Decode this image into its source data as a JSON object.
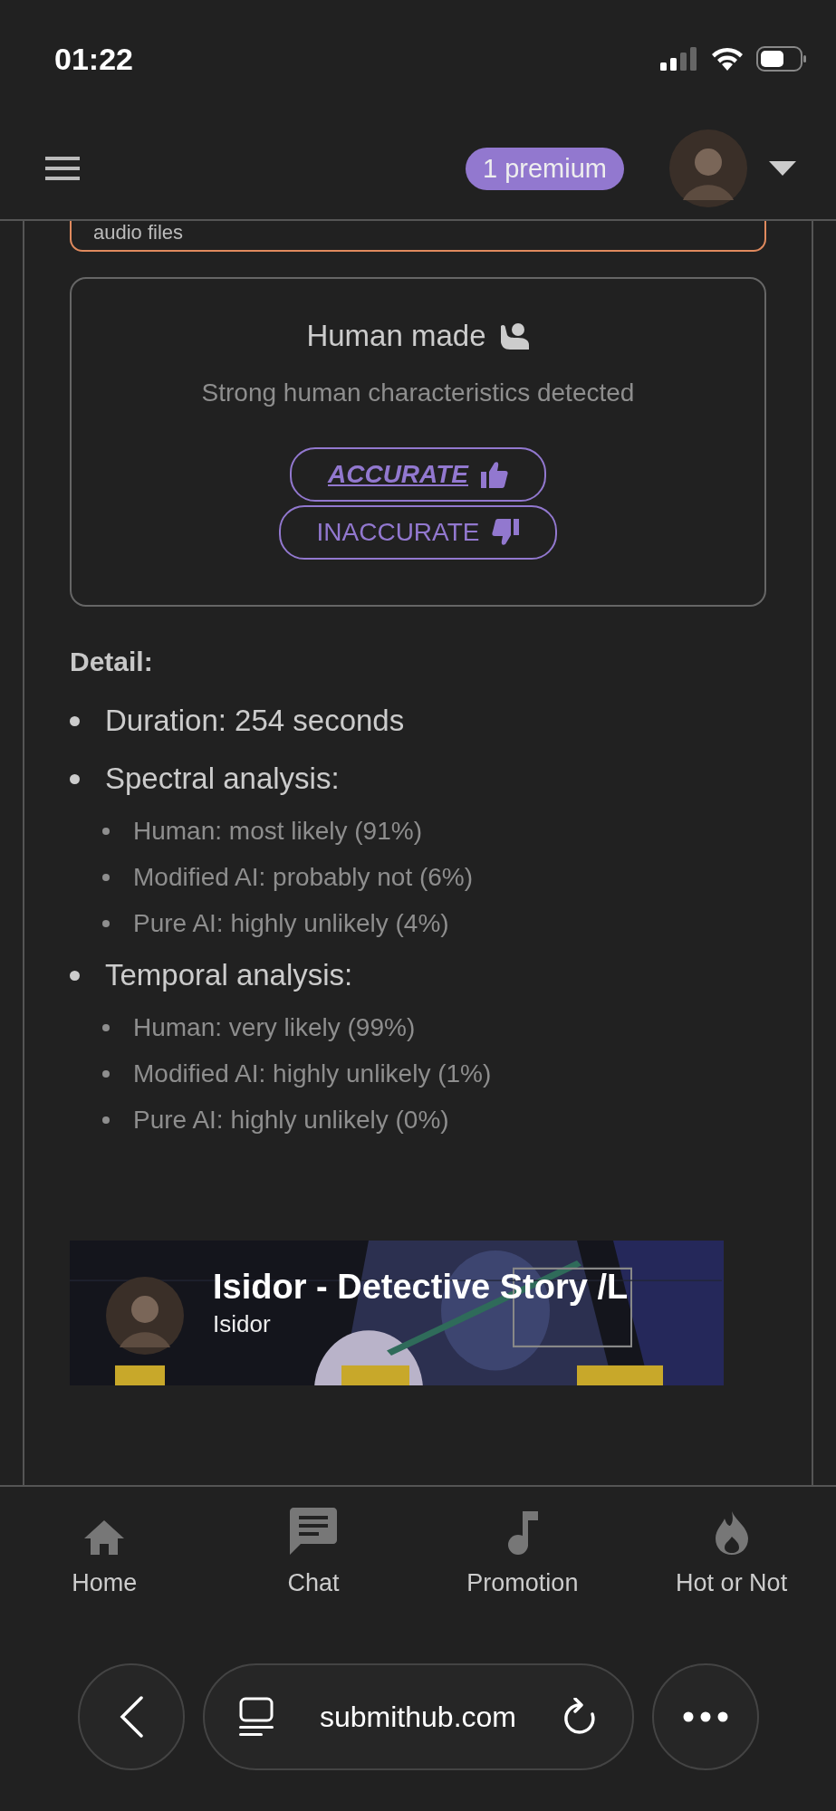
{
  "status_bar": {
    "time": "01:22"
  },
  "header": {
    "badge": "1 premium"
  },
  "previous_card": {
    "text": "audio files"
  },
  "result_card": {
    "title": "Human made",
    "subtitle": "Strong human characteristics detected",
    "buttons": [
      {
        "label": "ACCURATE",
        "kind": "up",
        "selected": true
      },
      {
        "label": "INACCURATE",
        "kind": "down",
        "selected": false
      }
    ]
  },
  "detail": {
    "heading": "Detail:",
    "items": [
      {
        "text": "Duration: 254 seconds"
      },
      {
        "text": "Spectral analysis:",
        "children": [
          {
            "text": "Human: most likely (91%)"
          },
          {
            "text": "Modified AI: probably not (6%)"
          },
          {
            "text": "Pure AI: highly unlikely (4%)"
          }
        ]
      },
      {
        "text": "Temporal analysis:",
        "children": [
          {
            "text": "Human: very likely (99%)"
          },
          {
            "text": "Modified AI: highly unlikely (1%)"
          },
          {
            "text": "Pure AI: highly unlikely (0%)"
          }
        ]
      }
    ]
  },
  "video": {
    "title": "Isidor - Detective Story /L",
    "channel": "Isidor"
  },
  "bottom_nav": [
    {
      "label": "Home",
      "kind": "home"
    },
    {
      "label": "Chat",
      "kind": "chat"
    },
    {
      "label": "Promotion",
      "kind": "music"
    },
    {
      "label": "Hot or Not",
      "kind": "flame"
    }
  ],
  "browser": {
    "url": "submithub.com"
  }
}
